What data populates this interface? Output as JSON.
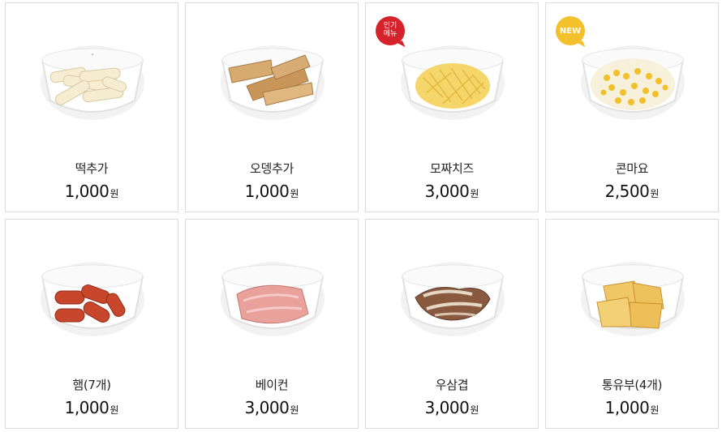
{
  "products": [
    {
      "name": "떡추가",
      "price": "1,000",
      "unit": "원",
      "badge": "",
      "icon": "tteok-dish-icon"
    },
    {
      "name": "오뎅추가",
      "price": "1,000",
      "unit": "원",
      "badge": "",
      "icon": "fishcake-dish-icon"
    },
    {
      "name": "모짜치즈",
      "price": "3,000",
      "unit": "원",
      "badge": "인기 메뉴",
      "icon": "mozzarella-dish-icon"
    },
    {
      "name": "콘마요",
      "price": "2,500",
      "unit": "원",
      "badge": "NEW",
      "icon": "corn-mayo-dish-icon"
    },
    {
      "name": "햄(7개)",
      "price": "1,000",
      "unit": "원",
      "badge": "",
      "icon": "sausage-dish-icon"
    },
    {
      "name": "베이컨",
      "price": "3,000",
      "unit": "원",
      "badge": "",
      "icon": "bacon-dish-icon"
    },
    {
      "name": "우삼겹",
      "price": "3,000",
      "unit": "원",
      "badge": "",
      "icon": "beef-brisket-dish-icon"
    },
    {
      "name": "통유부(4개)",
      "price": "1,000",
      "unit": "원",
      "badge": "",
      "icon": "fried-tofu-dish-icon"
    }
  ],
  "badges": {
    "hot_line1": "인기",
    "hot_line2": "메뉴",
    "new": "NEW"
  },
  "colors": {
    "hot_badge": "#d6222a",
    "new_badge": "#f4c12d",
    "border": "#dcdcdc"
  }
}
